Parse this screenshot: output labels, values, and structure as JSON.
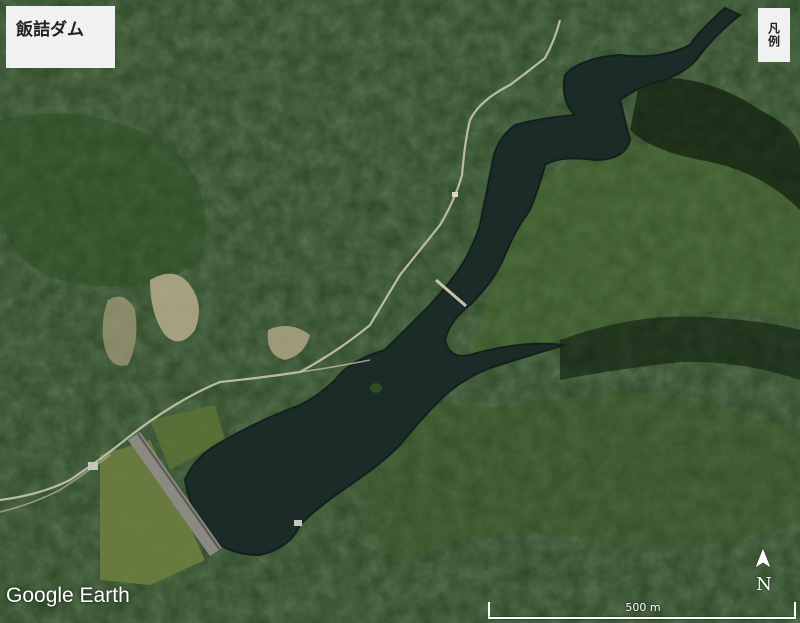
{
  "map": {
    "title": "飯詰ダム",
    "legend_button": "凡例",
    "attribution": "Google Earth",
    "north_label": "N",
    "scale_label": "500 m",
    "colors": {
      "forest_dark": "#1f3a1c",
      "forest_light": "#3f5f2e",
      "water": "#1a2a27",
      "road": "#c9c4b0",
      "bare_ground": "#b9ad8a",
      "dam_wall": "#8a8a82",
      "field": "#6f7f3e"
    },
    "features": [
      "reservoir",
      "dam",
      "road",
      "bridge",
      "forest",
      "quarry"
    ]
  }
}
